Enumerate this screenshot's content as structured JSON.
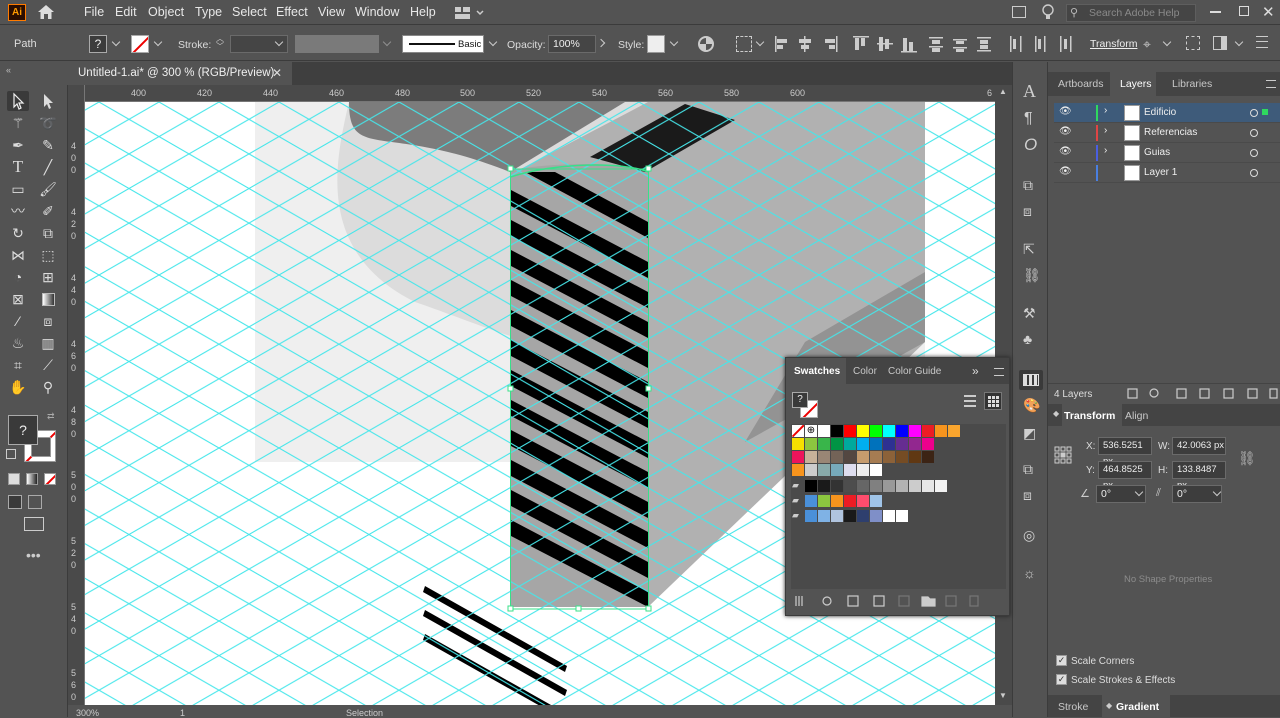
{
  "app": {
    "logo": "Ai"
  },
  "menu": [
    "File",
    "Edit",
    "Object",
    "Type",
    "Select",
    "Effect",
    "View",
    "Window",
    "Help"
  ],
  "search": {
    "placeholder": "Search Adobe Help"
  },
  "control": {
    "selection_type": "Path",
    "fill_label": "?",
    "stroke_label": "Stroke:",
    "brush": "Basic",
    "opacity_label": "Opacity:",
    "opacity": "100%",
    "style_label": "Style:",
    "transform": "Transform"
  },
  "document": {
    "tab": "Untitled-1.ai* @ 300 % (RGB/Preview)"
  },
  "rulers": {
    "h": [
      "400",
      "420",
      "440",
      "460",
      "480",
      "500",
      "520",
      "540",
      "560",
      "580",
      "600",
      "6"
    ],
    "v": [
      "4\n0\n0",
      "4\n2\n0",
      "4\n4\n0",
      "4\n6\n0",
      "4\n8\n0",
      "5\n0\n0",
      "5\n2\n0",
      "5\n4\n0",
      "5\n6\n0"
    ]
  },
  "toolbox": {
    "fill": "?"
  },
  "status": {
    "zoom": "300%",
    "artboard": "1",
    "mode": "Selection"
  },
  "panels": {
    "tabs": [
      "Artboards",
      "Layers",
      "Libraries"
    ],
    "active_tab": "Layers"
  },
  "layers": [
    {
      "name": "Edificio",
      "color": "#2fd85f",
      "selected": true
    },
    {
      "name": "Referencias",
      "color": "#e04545",
      "selected": false
    },
    {
      "name": "Guias",
      "color": "#4a5fe0",
      "selected": false
    },
    {
      "name": "Layer 1",
      "color": "#4a7fe0",
      "selected": false
    }
  ],
  "layers_count": "4 Layers",
  "transform": {
    "tabs": [
      "Transform",
      "Align"
    ],
    "x_label": "X:",
    "x": "536.5251 px",
    "y_label": "Y:",
    "y": "464.8525 px",
    "w_label": "W:",
    "w": "42.0063 px",
    "h_label": "H:",
    "h": "133.8487 px",
    "rotate": "0°",
    "shear": "0°",
    "no_shape": "No Shape Properties",
    "scale_corners": "Scale Corners",
    "scale_strokes": "Scale Strokes & Effects"
  },
  "bottom_tabs": [
    "Stroke",
    "Gradient"
  ],
  "swatches_panel": {
    "tabs": [
      "Swatches",
      "Color",
      "Color Guide"
    ],
    "active": "Swatches",
    "fill": "?"
  },
  "swatch_rows": [
    [
      "#ffffff",
      "#000000",
      "#ff0000",
      "#ffff00",
      "#00ff00",
      "#00ffff",
      "#0000ff",
      "#ff00ff",
      "#ed1c24",
      "#f7941d",
      "#f9a52e"
    ],
    [
      "#f5e000",
      "#8cc63f",
      "#39b54a",
      "#009444",
      "#00a99d",
      "#00aeef",
      "#0072bc",
      "#2e3192",
      "#662d91",
      "#92278f",
      "#ec008c"
    ],
    [
      "#ed145b",
      "#c7b299",
      "#998675",
      "#736357",
      "#534741",
      "#c69c6d",
      "#a67c52",
      "#8c6239",
      "#754c24",
      "#603813",
      "#3c2415"
    ],
    [
      "#ffffff",
      "#e6e6e6",
      "#cccccc",
      "#b3b3b3",
      "#999999",
      "#808080",
      "#666666",
      "#4d4d4d",
      "#333333",
      "#1a1a1a",
      "#000000"
    ]
  ],
  "group_rows": [
    [
      "#000000",
      "#1a1a1a",
      "#333333",
      "#4d4d4d",
      "#666666",
      "#808080",
      "#999999",
      "#b3b3b3",
      "#cccccc",
      "#e6e6e6",
      "#f2f2f2"
    ],
    [
      "#4a90d9",
      "#8cc63f",
      "#f7941d",
      "#ed1c24",
      "#ff4d6d",
      "#a0c4e8"
    ],
    [
      "#4a90d9",
      "#7fb2e5",
      "#b0c4de",
      "#1a1a1a",
      "#2e3f6e",
      "#7f8fc8",
      "#ffffff",
      "#ffffff"
    ]
  ]
}
